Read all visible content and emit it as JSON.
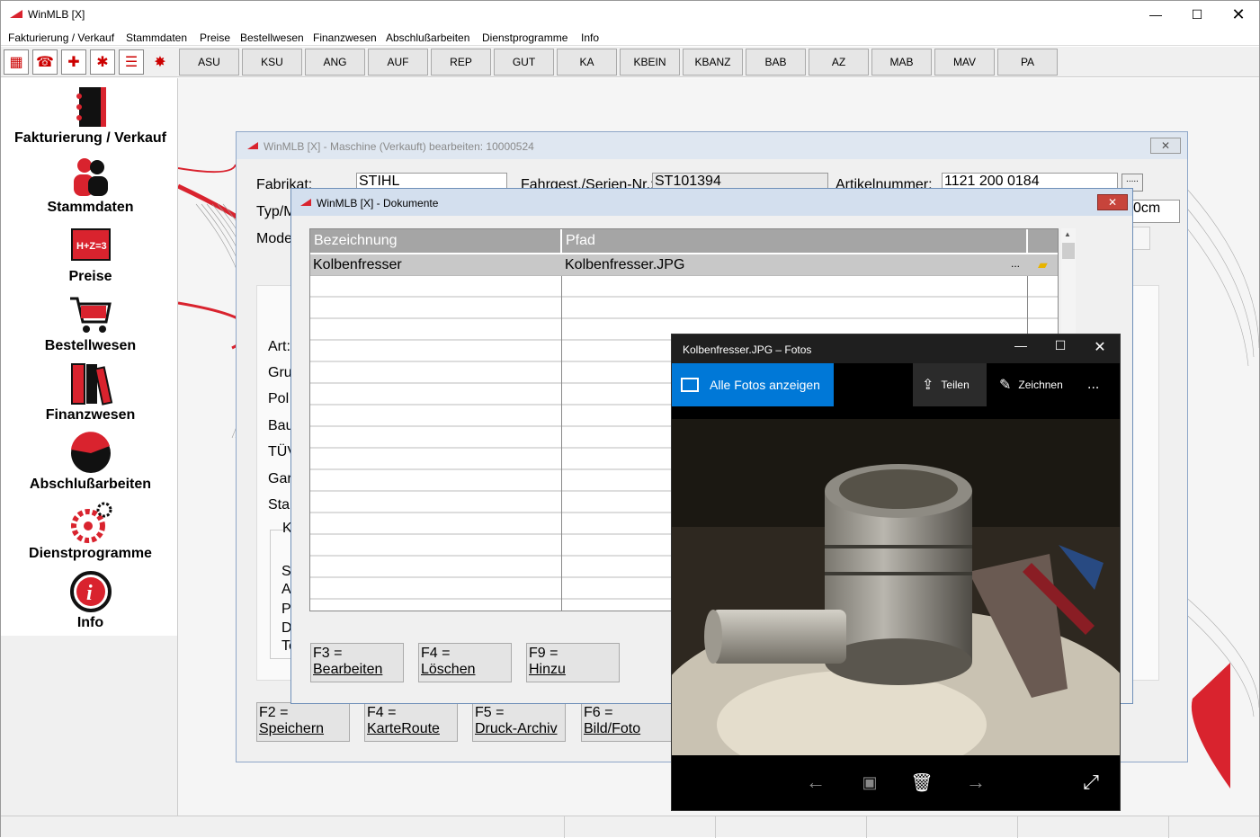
{
  "app": {
    "title": "WinMLB [X]",
    "accent": "#d9232e"
  },
  "menu": [
    "Fakturierung / Verkauf",
    "Stammdaten",
    "Preise",
    "Bestellwesen",
    "Finanzwesen",
    "Abschlußarbeiten",
    "Dienstprogramme",
    "Info"
  ],
  "toolbar": {
    "icons": [
      "invoice-icon",
      "phone-icon",
      "medical-kit-icon",
      "gear-wheel-icon",
      "checklist-icon",
      "star-icon"
    ],
    "buttons": [
      "ASU",
      "KSU",
      "ANG",
      "AUF",
      "REP",
      "GUT",
      "KA",
      "KBEIN",
      "KBANZ",
      "BAB",
      "AZ",
      "MAB",
      "MAV",
      "PA"
    ]
  },
  "sidebar": [
    {
      "label": "Fakturierung / Verkauf",
      "icon": "binder-icon"
    },
    {
      "label": "Stammdaten",
      "icon": "users-icon"
    },
    {
      "label": "Preise",
      "icon": "formula-board-icon"
    },
    {
      "label": "Bestellwesen",
      "icon": "shopping-cart-icon"
    },
    {
      "label": "Finanzwesen",
      "icon": "ledger-books-icon"
    },
    {
      "label": "Abschlußarbeiten",
      "icon": "pie-chart-icon"
    },
    {
      "label": "Dienstprogramme",
      "icon": "gears-icon"
    },
    {
      "label": "Info",
      "icon": "info-icon"
    }
  ],
  "machine_dialog": {
    "title": "WinMLB [X] - Maschine (Verkauft) bearbeiten: 10000524",
    "close": "✕",
    "labels": {
      "fabrikat": "Fabrikat:",
      "seriennr": "Fahrgest./Serien-Nr.:",
      "artikelnr": "Artikelnummer:",
      "typ": "Typ/M",
      "modell": "Mode",
      "art": "Art:",
      "gru": "Gru",
      "pol": "Pol",
      "bau": "Bau",
      "tuev": "TÜV",
      "gar": "Gar",
      "sta": "Sta",
      "k": "K",
      "s": "S",
      "a": "A",
      "p": "P",
      "d": "D",
      "te": "Te"
    },
    "values": {
      "fabrikat": "STIHL",
      "seriennr": "ST101394",
      "artikelnr": "1121 200 0184",
      "partial_cm": "0cm",
      "dots": "....."
    },
    "fkeys": [
      {
        "key": "F2 =",
        "label": "Speichern"
      },
      {
        "key": "F4 =",
        "label": "KarteRoute"
      },
      {
        "key": "F5 =",
        "label": "Druck-Archiv"
      },
      {
        "key": "F6 =",
        "label": "Bild/Foto"
      }
    ]
  },
  "documents_dialog": {
    "title": "WinMLB [X] - Dokumente",
    "close": "✕",
    "columns": [
      "Bezeichnung",
      "Pfad"
    ],
    "rows": [
      {
        "bezeichnung": "Kolbenfresser",
        "pfad": "Kolbenfresser.JPG",
        "browse": "..."
      }
    ],
    "fkeys": [
      {
        "key": "F3 =",
        "label": "Bearbeiten"
      },
      {
        "key": "F4 =",
        "label": "Löschen"
      },
      {
        "key": "F9 =",
        "label": "Hinzu"
      }
    ]
  },
  "photos_app": {
    "title": "Kolbenfresser.JPG – Fotos",
    "all_photos": "Alle Fotos anzeigen",
    "share": "Teilen",
    "draw": "Zeichnen",
    "more": "...",
    "accent": "#0078d7"
  }
}
